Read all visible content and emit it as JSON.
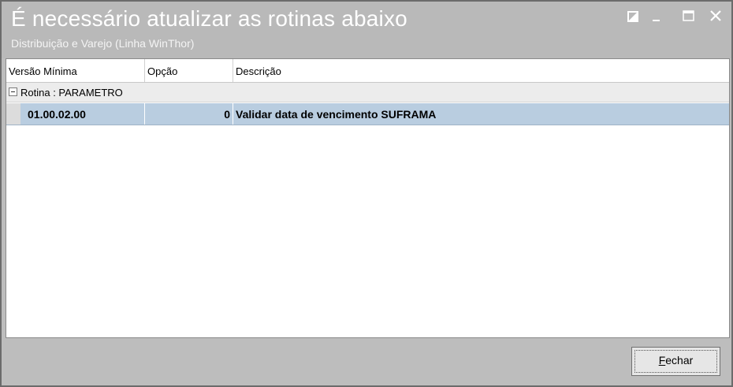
{
  "window": {
    "title": "É necessário atualizar as rotinas abaixo",
    "subtitle": "Distribuição e Varejo (Linha WinThor)"
  },
  "columns": [
    "Versão Mínima",
    "Opção",
    "Descrição"
  ],
  "group": {
    "label": "Rotina : PARAMETRO",
    "expanded": true
  },
  "rows": [
    {
      "versao": "01.00.02.00",
      "opcao": "0",
      "descricao": "Validar data de vencimento SUFRAMA"
    }
  ],
  "buttons": {
    "close_label": "Fechar",
    "close_accel": "F"
  },
  "icons": {
    "restore": "restore-icon",
    "minimize": "minimize-icon",
    "maximize": "maximize-icon",
    "close": "close-icon"
  },
  "colors": {
    "titlebar": "#b9b9b9",
    "selected_row": "#b9cde0",
    "group_row": "#ececec"
  }
}
